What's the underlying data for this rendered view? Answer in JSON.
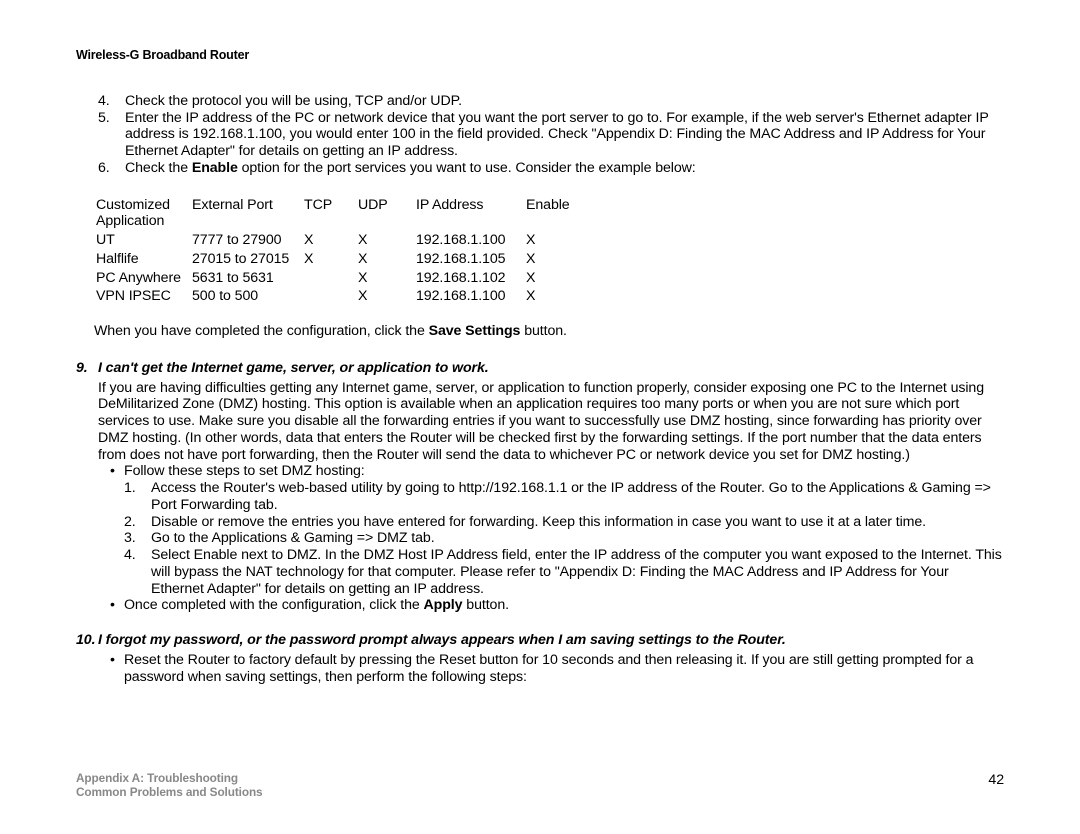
{
  "header": "Wireless-G Broadband Router",
  "steps": {
    "s4": "Check the protocol you will be using, TCP and/or UDP.",
    "s5": "Enter the IP address of the PC or network device that you want the port server to go to. For example, if the web server's Ethernet adapter IP address is 192.168.1.100, you would enter 100 in the field provided. Check \"Appendix D: Finding the MAC Address and IP Address for Your Ethernet Adapter\" for details on getting an IP address.",
    "s6a": "Check the ",
    "s6b": "Enable",
    "s6c": " option for the port services you want to use. Consider the example below:"
  },
  "table": {
    "h1a": "Customized",
    "h1b": "Application",
    "h2": "External Port",
    "h3": "TCP",
    "h4": "UDP",
    "h5": "IP Address",
    "h6": "Enable",
    "r1": {
      "a": "UT",
      "b": "7777 to 27900",
      "c": "X",
      "d": "X",
      "e": "192.168.1.100",
      "f": "X"
    },
    "r2": {
      "a": "Halflife",
      "b": "27015 to 27015",
      "c": "X",
      "d": "X",
      "e": "192.168.1.105",
      "f": "X"
    },
    "r3": {
      "a": "PC Anywhere",
      "b": "5631 to 5631",
      "c": "",
      "d": "X",
      "e": "192.168.1.102",
      "f": "X"
    },
    "r4": {
      "a": "VPN IPSEC",
      "b": "500 to 500",
      "c": "",
      "d": "X",
      "e": "192.168.1.100",
      "f": "X"
    }
  },
  "save": {
    "a": "When you have completed the configuration, click the ",
    "b": "Save Settings",
    "c": " button."
  },
  "q9": {
    "num": "9.",
    "title": "I can't get the Internet game, server, or application to work.",
    "body": "If you are having difficulties getting any Internet game, server, or application to function properly, consider exposing one PC to the Internet using DeMilitarized Zone (DMZ) hosting. This option is available when an application requires too many ports or when you are not sure which port services to use. Make sure you disable all the forwarding entries if you want to successfully use DMZ hosting, since forwarding has priority over DMZ hosting. (In other words, data that enters the Router will be checked first by the forwarding settings. If the port number that the data enters from does not have port forwarding, then the Router will send the data to whichever PC or network device you set for DMZ hosting.)",
    "bul1": "Follow these steps to set DMZ hosting:",
    "ol": {
      "i1": "Access the Router's web-based utility by going to http://192.168.1.1 or the IP address of the Router. Go to the Applications & Gaming => Port Forwarding tab.",
      "i2": "Disable or remove the entries you have entered for forwarding.  Keep this information in case you want to use it at a later time.",
      "i3": "Go to the Applications & Gaming => DMZ tab.",
      "i4": "Select Enable next to DMZ. In the DMZ Host IP Address field, enter the IP address of the computer you want exposed to the Internet.  This will bypass the NAT technology for that computer. Please refer to \"Appendix D: Finding the MAC Address and IP Address for Your Ethernet Adapter\" for details on getting an IP address."
    },
    "bul2a": "Once completed with the configuration, click the ",
    "bul2b": "Apply",
    "bul2c": " button."
  },
  "q10": {
    "num": "10.",
    "title": "I forgot my password, or the password prompt always appears when I am saving settings to the Router.",
    "bul1": "Reset the Router to factory default by pressing the Reset button for 10 seconds and then releasing it. If you are still getting prompted for a password when saving settings, then perform the following steps:"
  },
  "footer": {
    "l1": "Appendix A: Troubleshooting",
    "l2": "Common Problems and Solutions",
    "page": "42"
  }
}
